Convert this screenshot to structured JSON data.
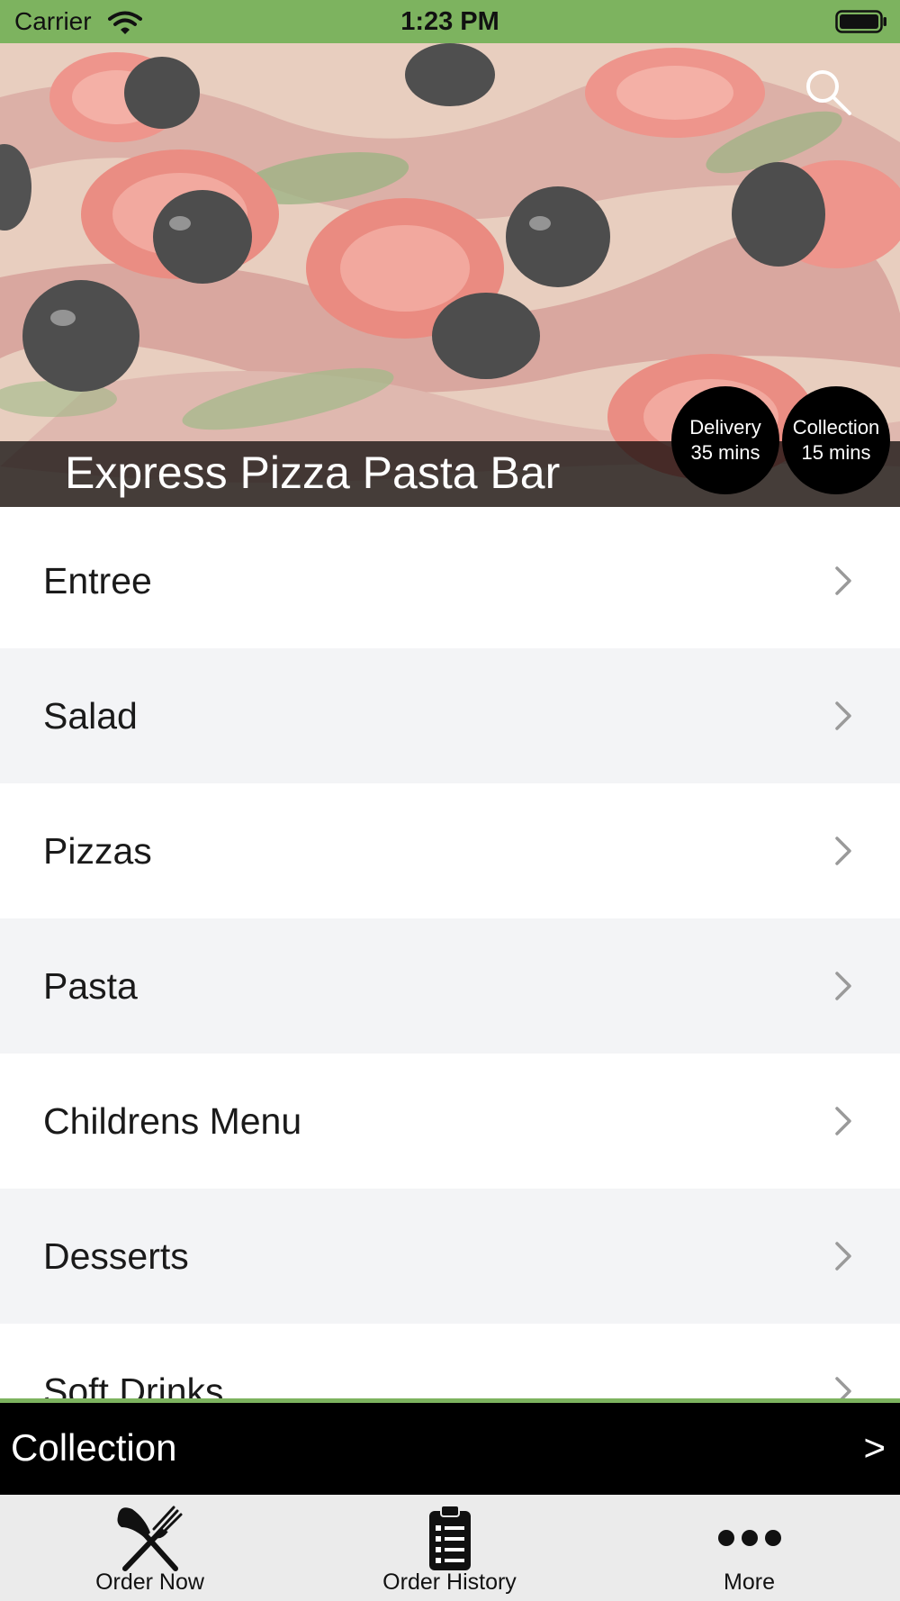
{
  "status_bar": {
    "carrier": "Carrier",
    "time": "1:23 PM",
    "background": "#7db35f"
  },
  "header": {
    "restaurant_name": "Express Pizza Pasta Bar",
    "search_icon": "search-icon",
    "delivery": {
      "label": "Delivery",
      "time": "35 mins"
    },
    "collection": {
      "label": "Collection",
      "time": "15 mins"
    }
  },
  "menu": {
    "items": [
      {
        "label": "Entree"
      },
      {
        "label": "Salad"
      },
      {
        "label": "Pizzas"
      },
      {
        "label": "Pasta"
      },
      {
        "label": "Childrens Menu"
      },
      {
        "label": "Desserts"
      },
      {
        "label": "Soft Drinks"
      }
    ]
  },
  "order_mode": {
    "label": "Collection",
    "arrow": ">"
  },
  "tab_bar": {
    "tabs": [
      {
        "label": "Order Now",
        "icon": "fork-knife-icon"
      },
      {
        "label": "Order History",
        "icon": "clipboard-icon"
      },
      {
        "label": "More",
        "icon": "ellipsis-icon"
      }
    ]
  },
  "colors": {
    "accent": "#7db35f",
    "dark": "#000000",
    "row_alt": "#f3f4f6"
  }
}
